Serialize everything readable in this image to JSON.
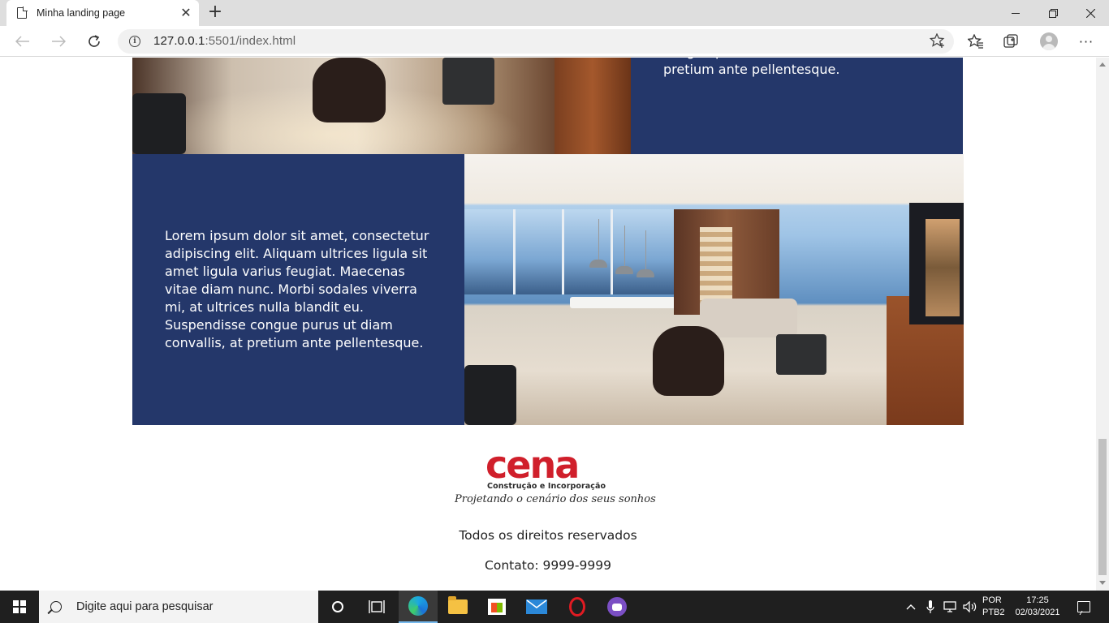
{
  "browser": {
    "tab_title": "Minha landing page",
    "url_host": "127.0.0.1",
    "url_rest": ":5501/index.html"
  },
  "page": {
    "top_block_text_fragment": "congue purus ut diam convallis, at pretium ante pellentesque.",
    "mid_block_text": "Lorem ipsum dolor sit amet, consectetur adipiscing elit. Aliquam ultrices ligula sit amet ligula varius feugiat. Maecenas vitae diam nunc. Morbi sodales viverra mi, at ultrices nulla blandit eu. Suspendisse congue purus ut diam convallis, at pretium ante pellentesque.",
    "logo": {
      "word": "cena",
      "subtitle": "Construção e Incorporação",
      "tagline": "Projetando o cenário dos seus sonhos"
    },
    "footer_rights": "Todos os direitos reservados",
    "footer_contact": "Contato: 9999-9999"
  },
  "taskbar": {
    "search_placeholder": "Digite aqui para pesquisar",
    "lang_line1": "POR",
    "lang_line2": "PTB2",
    "time": "17:25",
    "date": "02/03/2021"
  },
  "colors": {
    "block_blue": "#24376a",
    "logo_red": "#d01f2b"
  },
  "icons": [
    "page-icon",
    "close-icon",
    "plus-icon",
    "minimize-icon",
    "maximize-icon",
    "back-icon",
    "forward-icon",
    "reload-icon",
    "info-icon",
    "favorite-add-icon",
    "favorites-icon",
    "collections-icon",
    "profile-icon",
    "more-icon",
    "windows-icon",
    "search-icon",
    "cortana-icon",
    "task-view-icon",
    "edge-icon",
    "file-explorer-icon",
    "store-icon",
    "mail-icon",
    "opera-icon",
    "app-icon",
    "chevron-up-icon",
    "microphone-icon",
    "network-icon",
    "volume-icon",
    "notification-icon"
  ]
}
